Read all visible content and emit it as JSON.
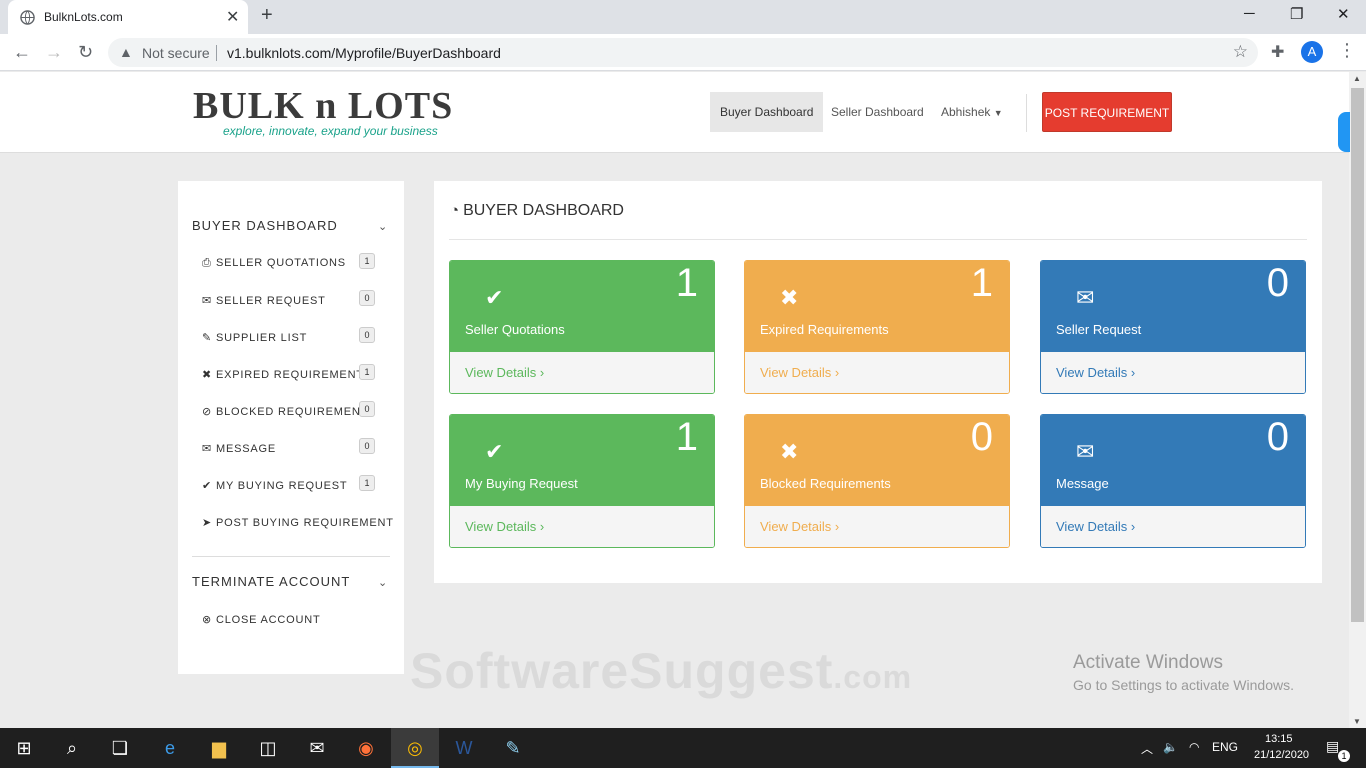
{
  "browser": {
    "tab_title": "BulknLots.com",
    "tab_close": "✕",
    "new_tab": "+",
    "not_secure": "Not secure",
    "url": "v1.bulknlots.com/Myprofile/BuyerDashboard",
    "profile_initial": "A"
  },
  "header": {
    "logo_text": "BULK n LOTS",
    "logo_tagline": "explore, innovate, expand your business",
    "nav": {
      "buyer_dashboard": "Buyer Dashboard",
      "seller_dashboard": "Seller Dashboard",
      "user": "Abhishek"
    },
    "post_requirement": "POST REQUIREMENT"
  },
  "sidebar": {
    "buyer_heading": "BUYER DASHBOARD",
    "items": [
      {
        "label": "SELLER QUOTATIONS",
        "icon": "print-icon",
        "badge": "1"
      },
      {
        "label": "SELLER REQUEST",
        "icon": "envelope-icon",
        "badge": "0"
      },
      {
        "label": "SUPPLIER LIST",
        "icon": "edit-icon",
        "badge": "0"
      },
      {
        "label": "EXPIRED REQUIREMENTS",
        "icon": "times-icon",
        "badge": "1"
      },
      {
        "label": "BLOCKED REQUIREMENTS",
        "icon": "ban-icon",
        "badge": "0"
      },
      {
        "label": "MESSAGE",
        "icon": "envelope-icon",
        "badge": "0"
      },
      {
        "label": "MY BUYING REQUEST",
        "icon": "check-icon",
        "badge": "1"
      },
      {
        "label": "POST BUYING REQUIREMENT",
        "icon": "send-icon"
      }
    ],
    "terminate_heading": "TERMINATE ACCOUNT",
    "close_account": "CLOSE ACCOUNT"
  },
  "main": {
    "title": "BUYER DASHBOARD",
    "cards": [
      {
        "label": "Seller Quotations",
        "count": "1",
        "link": "View Details",
        "color": "#5cb85c",
        "icon": "check-icon"
      },
      {
        "label": "Expired Requirements",
        "count": "1",
        "link": "View Details",
        "color": "#f0ad4e",
        "icon": "times-icon"
      },
      {
        "label": "Seller Request",
        "count": "0",
        "link": "View Details",
        "color": "#337ab7",
        "icon": "envelope-icon"
      },
      {
        "label": "My Buying Request",
        "count": "1",
        "link": "View Details",
        "color": "#5cb85c",
        "icon": "check-icon"
      },
      {
        "label": "Blocked Requirements",
        "count": "0",
        "link": "View Details",
        "color": "#f0ad4e",
        "icon": "times-icon"
      },
      {
        "label": "Message",
        "count": "0",
        "link": "View Details",
        "color": "#337ab7",
        "icon": "envelope-icon"
      }
    ]
  },
  "watermarks": {
    "brand": "SoftwareSuggest",
    "brand_suffix": ".com",
    "activate_title": "Activate Windows",
    "activate_sub": "Go to Settings to activate Windows."
  },
  "taskbar": {
    "lang": "ENG",
    "time": "13:15",
    "date": "21/12/2020",
    "notif_count": "1"
  }
}
